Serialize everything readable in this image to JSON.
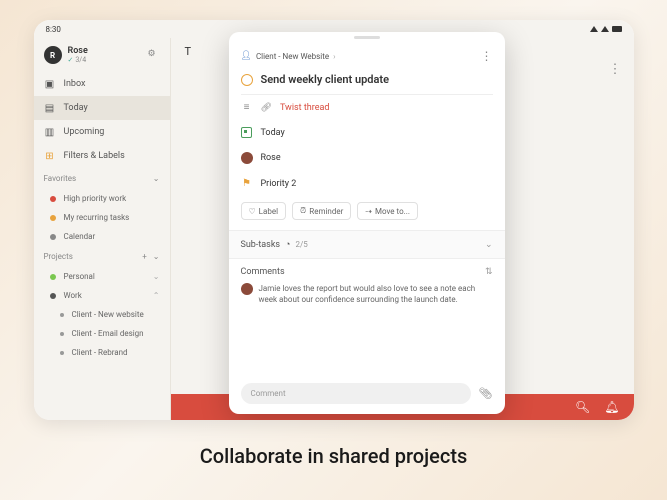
{
  "statusbar": {
    "time": "8:30"
  },
  "sidebar": {
    "user": {
      "name": "Rose",
      "initial": "R",
      "meta": "3/4"
    },
    "nav": [
      {
        "label": "Inbox",
        "icon": "inbox"
      },
      {
        "label": "Today",
        "icon": "today",
        "active": true
      },
      {
        "label": "Upcoming",
        "icon": "upcoming"
      },
      {
        "label": "Filters & Labels",
        "icon": "filters"
      }
    ],
    "favorites": {
      "title": "Favorites",
      "items": [
        {
          "label": "High priority work",
          "color": "#d84c3e"
        },
        {
          "label": "My recurring tasks",
          "color": "#e8a33d"
        },
        {
          "label": "Calendar",
          "color": "#888"
        }
      ]
    },
    "projects": {
      "title": "Projects",
      "items": [
        {
          "label": "Personal",
          "color": "#7ac74f",
          "expanded": false
        },
        {
          "label": "Work",
          "color": "#555",
          "expanded": true,
          "children": [
            {
              "label": "Client - New website"
            },
            {
              "label": "Client - Email design"
            },
            {
              "label": "Client - Rebrand"
            }
          ]
        }
      ]
    }
  },
  "main": {
    "header_initial": "T"
  },
  "modal": {
    "breadcrumb": {
      "project": "Client - New Website"
    },
    "title": "Send weekly client update",
    "link": {
      "label": "Twist thread"
    },
    "date": "Today",
    "assignee": "Rose",
    "priority": "Priority 2",
    "chips": {
      "label": "Label",
      "reminder": "Reminder",
      "moveto": "Move to..."
    },
    "subtasks": {
      "title": "Sub-tasks",
      "progress": "2/5"
    },
    "comments": {
      "title": "Comments",
      "items": [
        {
          "text": "Jamie loves the report but would also love to see a note each week about our confidence surrounding the launch date."
        }
      ]
    },
    "comment_placeholder": "Comment"
  },
  "caption": "Collaborate in shared projects"
}
